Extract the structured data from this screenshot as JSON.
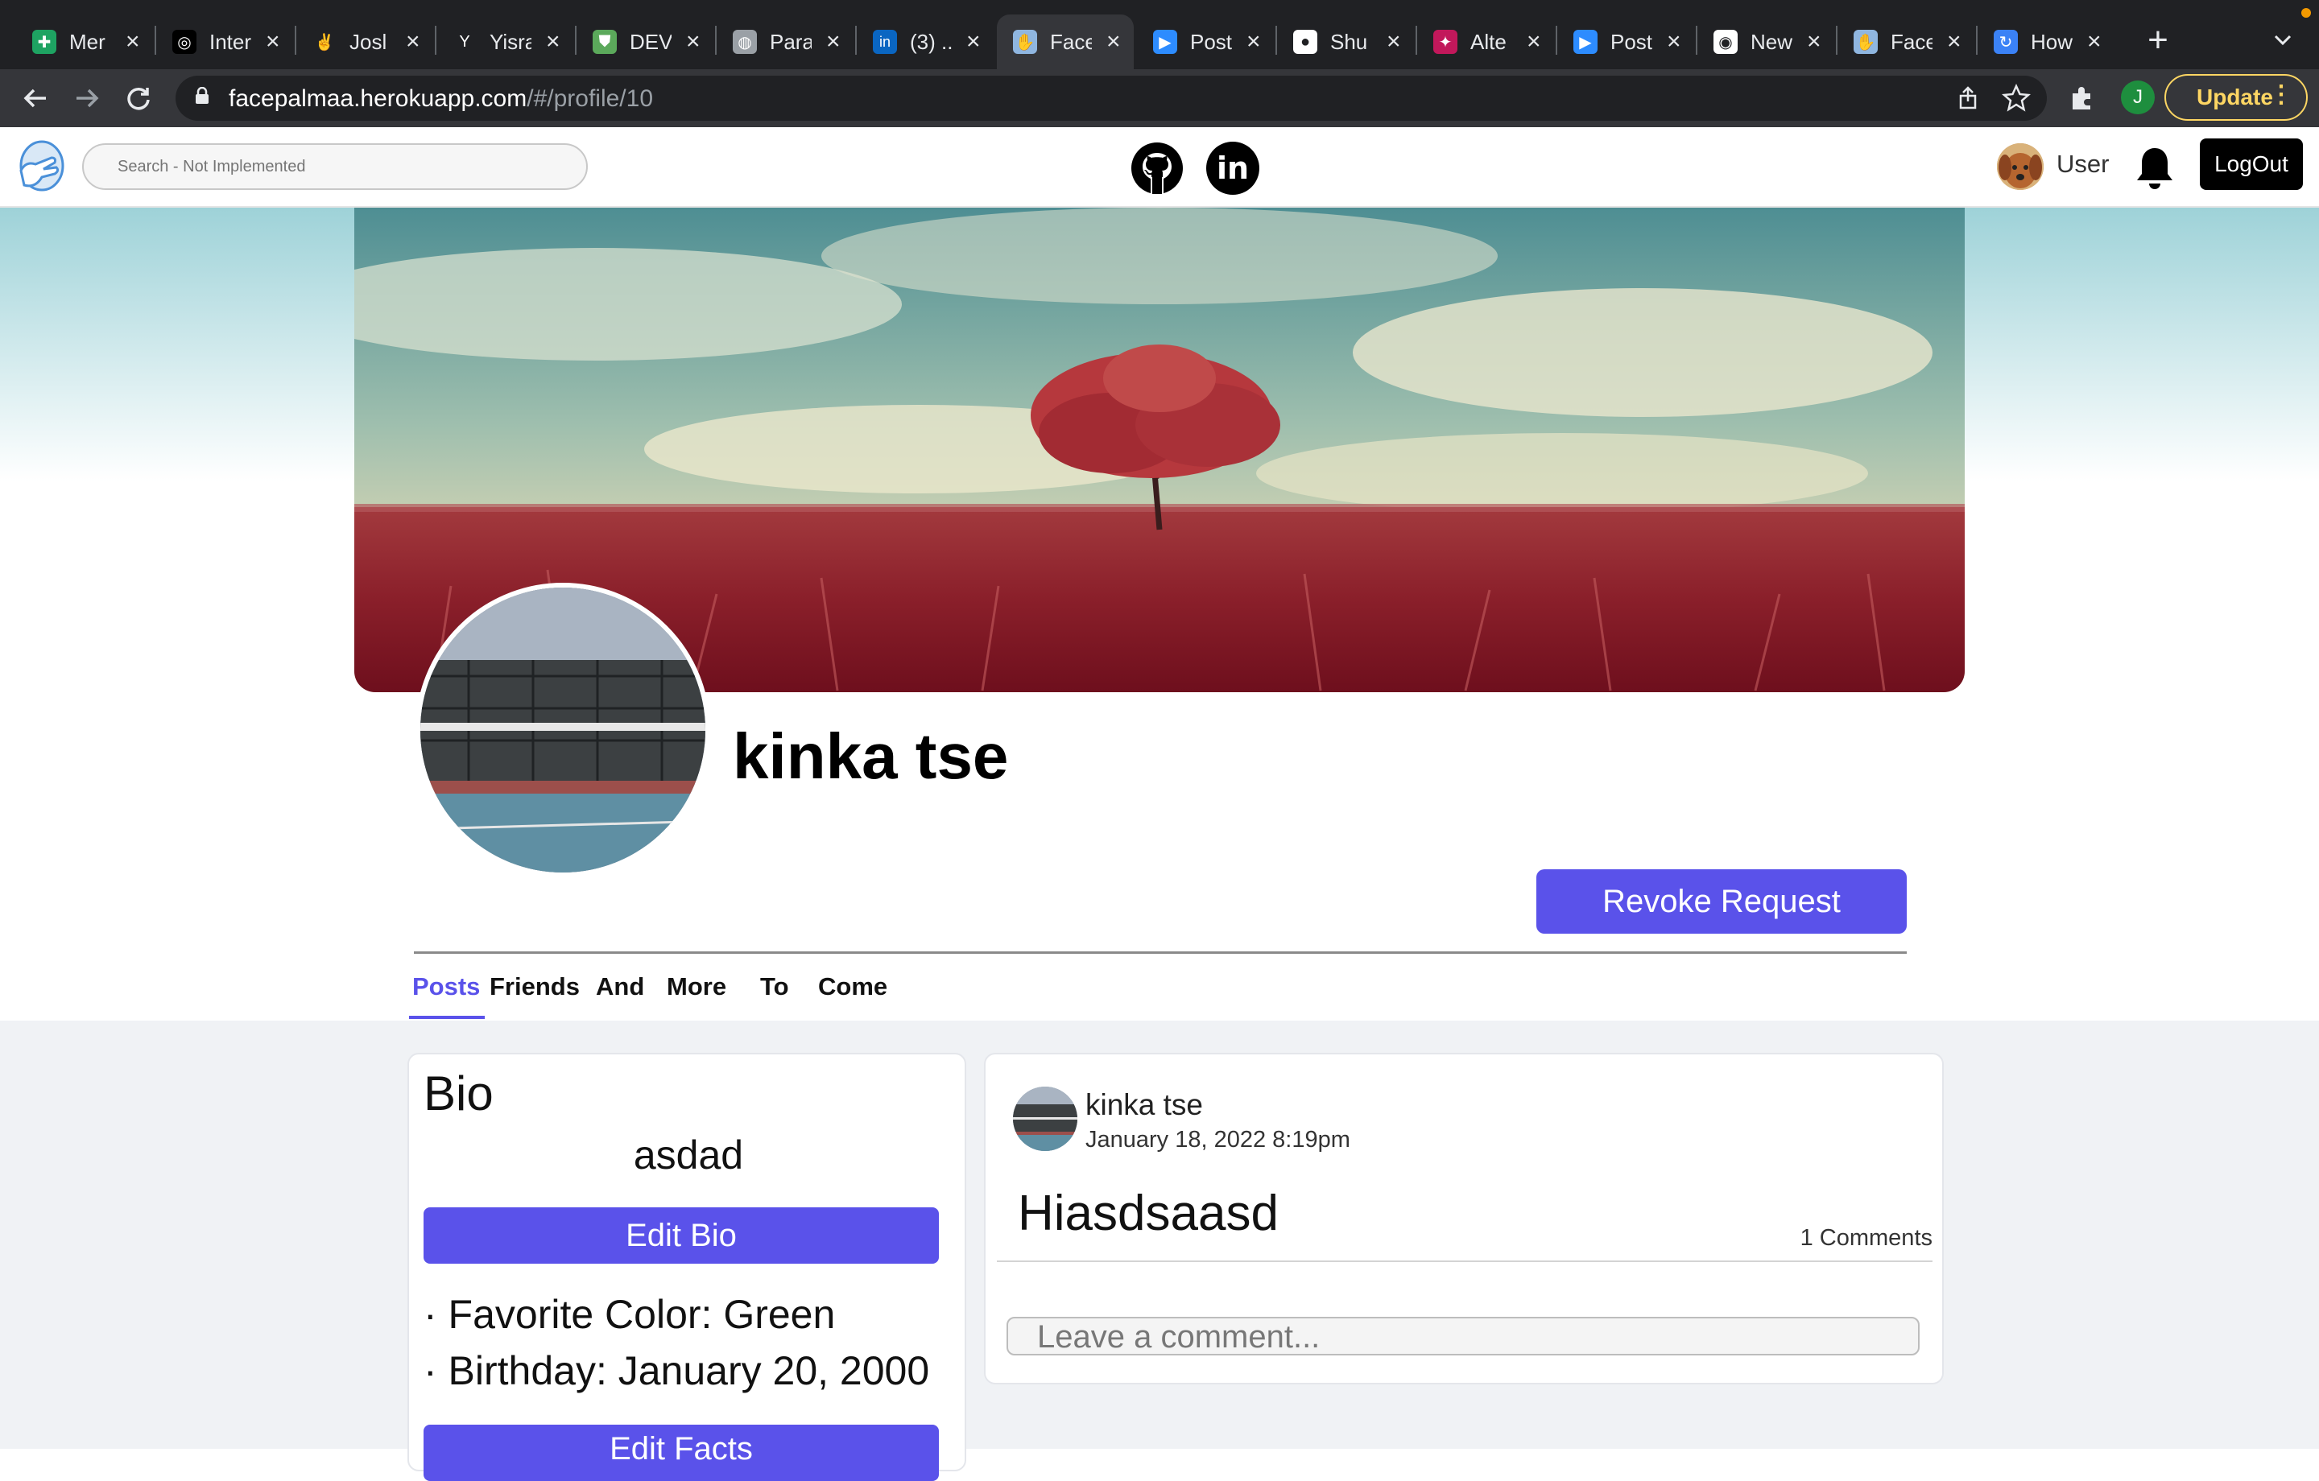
{
  "browser": {
    "tabs": [
      {
        "title": "Mer",
        "icon": "sheets-icon",
        "color": "#1ea362"
      },
      {
        "title": "Inter",
        "icon": "compass-icon",
        "color": "#000000"
      },
      {
        "title": "Josl",
        "icon": "peace-hand-icon",
        "color": "#202124"
      },
      {
        "title": "Yisra",
        "icon": "y-logo-icon",
        "color": "#202124"
      },
      {
        "title": "DEV",
        "icon": "shield-icon",
        "color": "#5ba95b"
      },
      {
        "title": "Para",
        "icon": "globe-icon",
        "color": "#9aa0a6"
      },
      {
        "title": "(3) ..",
        "icon": "linkedin-icon",
        "color": "#0a66c2"
      },
      {
        "title": "Face",
        "icon": "facepalm-icon",
        "color": "#8fb6e0"
      },
      {
        "title": "Post",
        "icon": "zoom-icon",
        "color": "#2d8cff"
      },
      {
        "title": "Shu",
        "icon": "github-icon",
        "color": "#ffffff"
      },
      {
        "title": "Alte",
        "icon": "alter-icon",
        "color": "#c2185b"
      },
      {
        "title": "Post",
        "icon": "zoom-icon",
        "color": "#2d8cff"
      },
      {
        "title": "New",
        "icon": "chrome-icon",
        "color": "#ffffff"
      },
      {
        "title": "Face",
        "icon": "facepalm-icon",
        "color": "#8fb6e0"
      },
      {
        "title": "How",
        "icon": "loading-icon",
        "color": "#3b82f6"
      }
    ],
    "active_tab": 7,
    "url_host": "facepalmaa.herokuapp.com",
    "url_path": "/#/profile/10",
    "update_label": "Update",
    "profile_initial": "J"
  },
  "appnav": {
    "search_placeholder": "Search - Not Implemented",
    "user_label": "User",
    "logout_label": "LogOut"
  },
  "profile": {
    "name": "kinka tse",
    "revoke_label": "Revoke Request",
    "tabs": [
      "Posts",
      "Friends",
      "And",
      "More",
      "To",
      "Come"
    ]
  },
  "bio_card": {
    "heading": "Bio",
    "text": "asdad",
    "edit_bio_label": "Edit Bio",
    "facts": [
      "· Favorite Color: Green",
      "· Birthday: January 20, 2000"
    ],
    "edit_facts_label": "Edit Facts"
  },
  "post": {
    "author": "kinka tse",
    "timestamp": "January 18, 2022 8:19pm",
    "body": "Hiasdsaasd",
    "comments_count": "1 Comments",
    "comment_placeholder": "Leave a comment..."
  }
}
